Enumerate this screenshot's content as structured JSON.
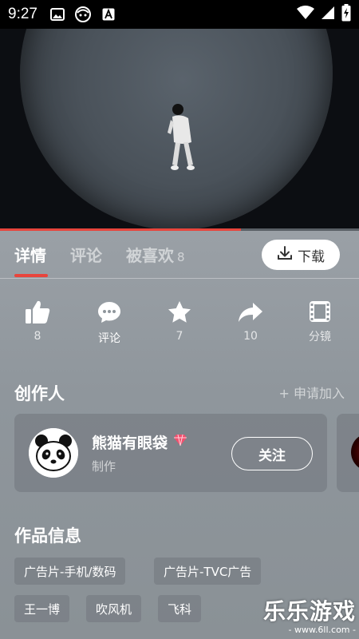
{
  "status_bar": {
    "time": "9:27",
    "left_icons": [
      "image-icon",
      "face-icon",
      "a-icon"
    ],
    "right_icons": [
      "wifi-icon",
      "signal-icon",
      "battery-charging-icon"
    ]
  },
  "video": {
    "progress_fraction": 0.67
  },
  "tabs": {
    "items": [
      {
        "label": "详情",
        "active": true
      },
      {
        "label": "评论",
        "active": false
      },
      {
        "label": "被喜欢",
        "count": "8",
        "active": false
      }
    ],
    "download_label": "下载"
  },
  "actions": {
    "like": {
      "icon": "thumbs-up-icon",
      "label": "8"
    },
    "comment": {
      "icon": "comment-icon",
      "label": "评论"
    },
    "favorite": {
      "icon": "star-icon",
      "label": "7"
    },
    "share": {
      "icon": "share-icon",
      "label": "10"
    },
    "storyboard": {
      "icon": "film-icon",
      "label": "分镜"
    }
  },
  "creators": {
    "title": "创作人",
    "apply_label": "+ 申请加入",
    "card": {
      "name": "熊猫有眼袋",
      "role": "制作",
      "follow_label": "关注",
      "badge_icon": "diamond-icon"
    }
  },
  "work_info": {
    "title": "作品信息",
    "tags": [
      "广告片-手机/数码",
      "广告片-TVC广告",
      "王一博",
      "吹风机",
      "飞科"
    ]
  },
  "watermark": {
    "title": "乐乐游戏",
    "url": "- www.6ll.com -"
  },
  "colors": {
    "accent": "#e8453c",
    "panel_bg": "#8e959c"
  }
}
